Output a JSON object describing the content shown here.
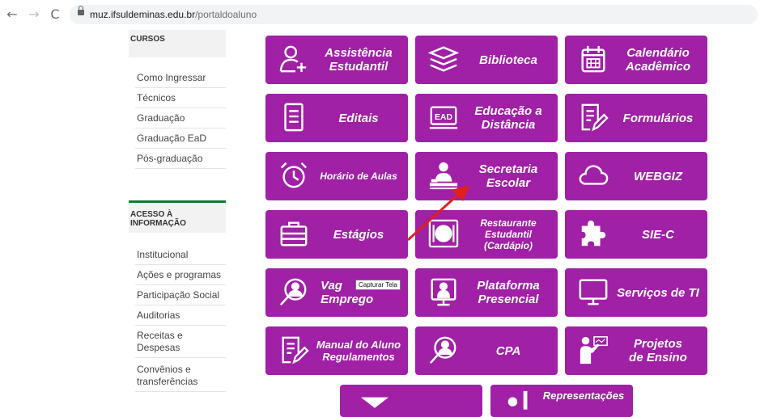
{
  "browser": {
    "back_icon": "back-arrow-icon",
    "forward_icon": "forward-arrow-icon",
    "reload_icon": "reload-icon",
    "url_domain": "muz.ifsuldeminas.edu.br",
    "url_path": "/portaldoaluno"
  },
  "sidebar": {
    "heading_cursos": "CURSOS",
    "cursos_items": [
      "Como Ingressar",
      "Técnicos",
      "Graduação",
      "Graduação EaD",
      "Pós-graduação"
    ],
    "heading_acesso": "ACESSO À\nINFORMAÇÃO",
    "acesso_items": [
      "Institucional",
      "Ações e programas",
      "Participação Social",
      "Auditorias",
      "Receitas e\nDespesas",
      "Convênios e\ntransferências"
    ]
  },
  "tiles": [
    {
      "label": "Assistência\nEstudantil",
      "icon": "user-add-icon"
    },
    {
      "label": "Biblioteca",
      "icon": "books-icon"
    },
    {
      "label": "Calendário\nAcadêmico",
      "icon": "calendar-icon"
    },
    {
      "label": "Editais",
      "icon": "document-icon"
    },
    {
      "label": "Educação a\nDistância",
      "icon": "ead-icon"
    },
    {
      "label": "Formulários",
      "icon": "form-edit-icon"
    },
    {
      "label": "Horário de Aulas",
      "icon": "alarm-clock-icon"
    },
    {
      "label": "Secretaria\nEscolar",
      "icon": "secretary-desk-icon"
    },
    {
      "label": "WEBGIZ",
      "icon": "cloud-icon"
    },
    {
      "label": "Estágios",
      "icon": "briefcase-icon"
    },
    {
      "label": "Restaurante\nEstudantil\n(Cardápio)",
      "icon": "plate-cutlery-icon"
    },
    {
      "label": "SIE-C",
      "icon": "puzzle-icon"
    },
    {
      "label": "Vag     de\nEmprego",
      "icon": "user-search-icon"
    },
    {
      "label": "Plataforma\nPresencial",
      "icon": "presenter-icon"
    },
    {
      "label": "Serviços de TI",
      "icon": "monitor-icon"
    },
    {
      "label": "Manual do Aluno\nRegulamentos",
      "icon": "manual-edit-icon"
    },
    {
      "label": "CPA",
      "icon": "user-search-icon"
    },
    {
      "label": "Projetos\nde Ensino",
      "icon": "teacher-board-icon"
    },
    {
      "label": "",
      "icon": "envelope-icon"
    },
    {
      "label": "Representações",
      "icon": "bars-icon"
    }
  ],
  "tooltip": "Capturar Tela",
  "colors": {
    "tile": "#a020a6",
    "heading_border": "#0f7a2e",
    "annotation_arrow": "#e0201a"
  }
}
